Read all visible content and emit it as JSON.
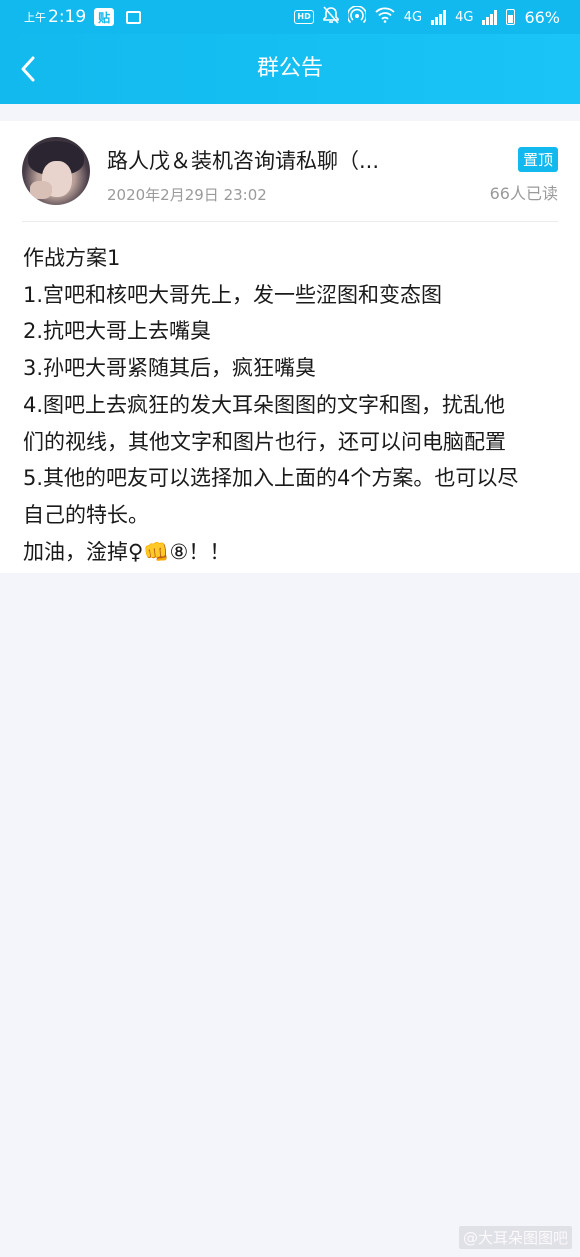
{
  "status_bar": {
    "time_prefix": "上午",
    "time": "2:19",
    "app_badge": "贴",
    "hd_label": "HD",
    "network_1": "4G",
    "network_2": "4G",
    "battery_percent": "66%"
  },
  "header": {
    "title": "群公告",
    "back_icon": "chevron-left-icon"
  },
  "announcement": {
    "poster_name": "路人戊＆装机咨询请私聊（...",
    "post_time": "2020年2月29日 23:02",
    "pin_label": "置顶",
    "read_count": "66人已读",
    "lines": [
      "作战方案1",
      "1.宫吧和核吧大哥先上，发一些涩图和变态图",
      "2.抗吧大哥上去嘴臭",
      "3.孙吧大哥紧随其后，疯狂嘴臭",
      "4.图吧上去疯狂的发大耳朵图图的文字和图，扰乱他",
      "们的视线，其他文字和图片也行，还可以问电脑配置",
      "5.其他的吧友可以选择加入上面的4个方案。也可以尽",
      "自己的特长。",
      "加油，淦掉♀👊⑧！！"
    ]
  },
  "watermark": "@大耳朵图图吧",
  "colors": {
    "accent": "#12b9ee",
    "page_bg": "#f4f4fb",
    "text": "#1a1a1a",
    "muted": "#9a9a9a"
  }
}
